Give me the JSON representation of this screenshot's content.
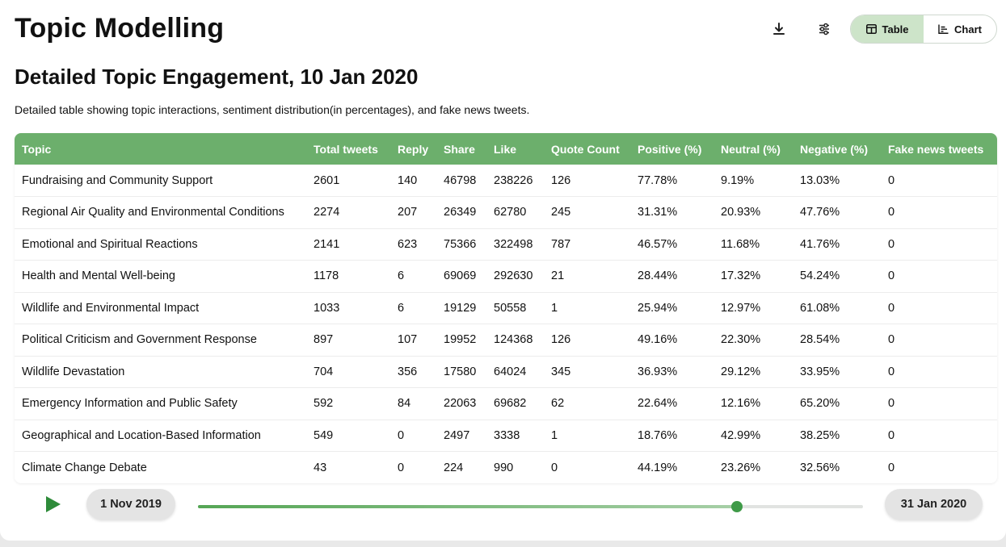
{
  "header": {
    "title": "Topic Modelling",
    "view_toggle": {
      "table_label": "Table",
      "chart_label": "Chart",
      "selected": "Table"
    }
  },
  "section": {
    "title": "Detailed Topic Engagement, 10 Jan 2020",
    "description": "Detailed table showing topic interactions, sentiment distribution(in percentages), and fake news tweets."
  },
  "table": {
    "columns": [
      "Topic",
      "Total tweets",
      "Reply",
      "Share",
      "Like",
      "Quote Count",
      "Positive (%)",
      "Neutral (%)",
      "Negative (%)",
      "Fake news tweets"
    ],
    "rows": [
      [
        "Fundraising and Community Support",
        "2601",
        "140",
        "46798",
        "238226",
        "126",
        "77.78%",
        "9.19%",
        "13.03%",
        "0"
      ],
      [
        "Regional Air Quality and Environmental Conditions",
        "2274",
        "207",
        "26349",
        "62780",
        "245",
        "31.31%",
        "20.93%",
        "47.76%",
        "0"
      ],
      [
        "Emotional and Spiritual Reactions",
        "2141",
        "623",
        "75366",
        "322498",
        "787",
        "46.57%",
        "11.68%",
        "41.76%",
        "0"
      ],
      [
        "Health and Mental Well-being",
        "1178",
        "6",
        "69069",
        "292630",
        "21",
        "28.44%",
        "17.32%",
        "54.24%",
        "0"
      ],
      [
        "Wildlife and Environmental Impact",
        "1033",
        "6",
        "19129",
        "50558",
        "1",
        "25.94%",
        "12.97%",
        "61.08%",
        "0"
      ],
      [
        "Political Criticism and Government Response",
        "897",
        "107",
        "19952",
        "124368",
        "126",
        "49.16%",
        "22.30%",
        "28.54%",
        "0"
      ],
      [
        "Wildlife Devastation",
        "704",
        "356",
        "17580",
        "64024",
        "345",
        "36.93%",
        "29.12%",
        "33.95%",
        "0"
      ],
      [
        "Emergency Information and Public Safety",
        "592",
        "84",
        "22063",
        "69682",
        "62",
        "22.64%",
        "12.16%",
        "65.20%",
        "0"
      ],
      [
        "Geographical and Location-Based Information",
        "549",
        "0",
        "2497",
        "3338",
        "1",
        "18.76%",
        "42.99%",
        "38.25%",
        "0"
      ],
      [
        "Climate Change Debate",
        "43",
        "0",
        "224",
        "990",
        "0",
        "44.19%",
        "23.26%",
        "32.56%",
        "0"
      ]
    ]
  },
  "timeline": {
    "start_label": "1 Nov 2019",
    "end_label": "31 Jan 2020",
    "position": 0.81
  },
  "icons": {
    "download": "download-icon",
    "settings": "sliders-icon",
    "table": "table-icon",
    "chart": "bar-chart-icon",
    "play": "play-icon"
  },
  "colors": {
    "header_green": "#6caf6c",
    "toggle_active": "#cde4c9",
    "slider_green": "#3f9a48"
  }
}
